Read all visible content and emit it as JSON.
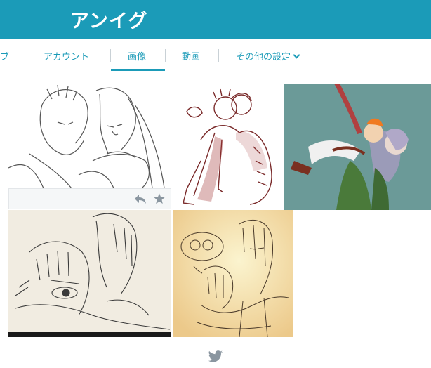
{
  "header": {
    "title": "アンイグ"
  },
  "tabs": [
    {
      "label": "ブ",
      "active": false
    },
    {
      "label": "アカウント",
      "active": false
    },
    {
      "label": "画像",
      "active": true
    },
    {
      "label": "動画",
      "active": false
    },
    {
      "label": "その他の設定",
      "active": false,
      "has_dropdown": true
    }
  ],
  "gallery": {
    "actions": {
      "reply_icon": "reply-icon",
      "favorite_icon": "star-icon"
    }
  },
  "footer": {
    "icon": "twitter-bird-icon"
  },
  "colors": {
    "accent": "#1b9bb8",
    "tile3_background": "#6b9a98",
    "tile5_background": "#f3e9a6"
  }
}
